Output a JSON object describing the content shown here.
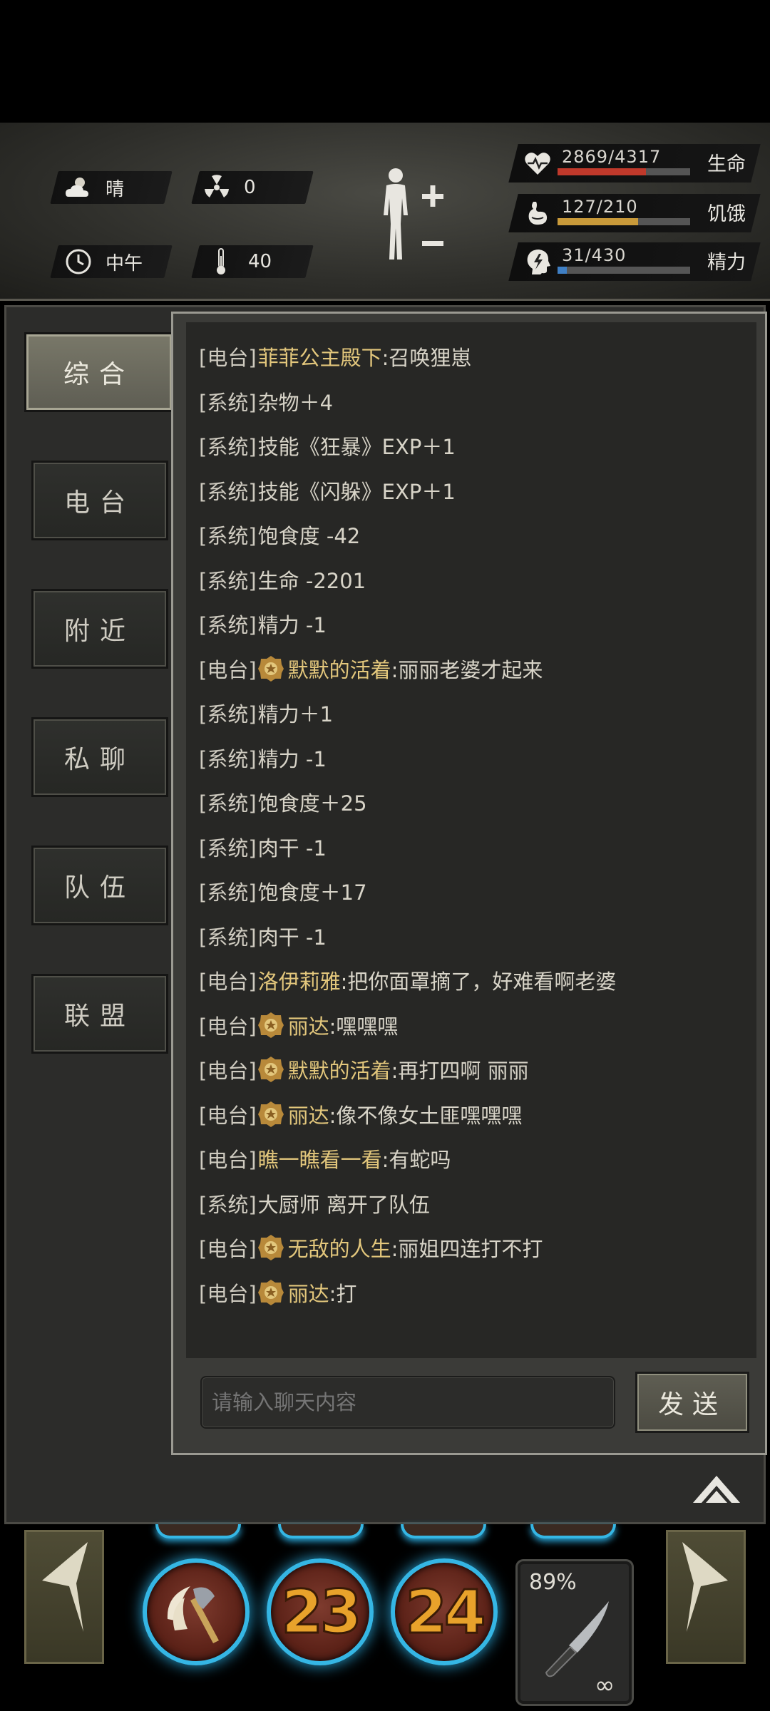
{
  "environment": {
    "weather": "晴",
    "radiation": "0",
    "time_of_day": "中午",
    "temperature": "40"
  },
  "stats": {
    "health": {
      "value": "2869/4317",
      "label": "生命",
      "fill": 0.665,
      "color": "#c0392b"
    },
    "hunger": {
      "value": "127/210",
      "label": "饥饿",
      "fill": 0.605,
      "color": "#c99a3a"
    },
    "energy": {
      "value": "31/430",
      "label": "精力",
      "fill": 0.072,
      "color": "#3f7fc4"
    }
  },
  "tabs": [
    {
      "label": "综合",
      "active": true
    },
    {
      "label": "电台",
      "active": false
    },
    {
      "label": "附近",
      "active": false
    },
    {
      "label": "私聊",
      "active": false
    },
    {
      "label": "队伍",
      "active": false
    },
    {
      "label": "联盟",
      "active": false
    }
  ],
  "chat": {
    "messages": [
      {
        "channel": "[电台]",
        "badge": false,
        "name": "菲菲公主殿下",
        "text": ":召唤狸崽"
      },
      {
        "channel": "[系统]",
        "badge": false,
        "name": "",
        "text": "杂物＋4"
      },
      {
        "channel": "[系统]",
        "badge": false,
        "name": "",
        "text": "技能《狂暴》EXP＋1"
      },
      {
        "channel": "[系统]",
        "badge": false,
        "name": "",
        "text": "技能《闪躲》EXP＋1"
      },
      {
        "channel": "[系统]",
        "badge": false,
        "name": "",
        "text": "饱食度 -42"
      },
      {
        "channel": "[系统]",
        "badge": false,
        "name": "",
        "text": "生命 -2201"
      },
      {
        "channel": "[系统]",
        "badge": false,
        "name": "",
        "text": "精力 -1"
      },
      {
        "channel": "[电台]",
        "badge": true,
        "name": "默默的活着",
        "text": ":丽丽老婆才起来"
      },
      {
        "channel": "[系统]",
        "badge": false,
        "name": "",
        "text": "精力＋1"
      },
      {
        "channel": "[系统]",
        "badge": false,
        "name": "",
        "text": "精力 -1"
      },
      {
        "channel": "[系统]",
        "badge": false,
        "name": "",
        "text": "饱食度＋25"
      },
      {
        "channel": "[系统]",
        "badge": false,
        "name": "",
        "text": "肉干 -1"
      },
      {
        "channel": "[系统]",
        "badge": false,
        "name": "",
        "text": "饱食度＋17"
      },
      {
        "channel": "[系统]",
        "badge": false,
        "name": "",
        "text": "肉干 -1"
      },
      {
        "channel": "[电台]",
        "badge": false,
        "name": "洛伊莉雅",
        "text": ":把你面罩摘了，好难看啊老婆"
      },
      {
        "channel": "[电台]",
        "badge": true,
        "name": "丽达",
        "text": ":嘿嘿嘿"
      },
      {
        "channel": "[电台]",
        "badge": true,
        "name": "默默的活着",
        "text": ":再打四啊 丽丽"
      },
      {
        "channel": "[电台]",
        "badge": true,
        "name": "丽达",
        "text": ":像不像女土匪嘿嘿嘿"
      },
      {
        "channel": "[电台]",
        "badge": false,
        "name": "瞧一瞧看一看",
        "text": ":有蛇吗"
      },
      {
        "channel": "[系统]",
        "badge": false,
        "name": "",
        "text": "大厨师 离开了队伍"
      },
      {
        "channel": "[电台]",
        "badge": true,
        "name": "无敌的人生",
        "text": ":丽姐四连打不打"
      },
      {
        "channel": "[电台]",
        "badge": true,
        "name": "丽达",
        "text": ":打"
      }
    ],
    "input_placeholder": "请输入聊天内容",
    "send_label": "发送"
  },
  "skills": {
    "slot2_cooldown": "23",
    "slot3_cooldown": "24",
    "weapon_durability": "89%",
    "weapon_ammo": "∞"
  },
  "colors": {
    "accent_name": "#e3c77c",
    "skill_glow": "#35b6e4"
  }
}
